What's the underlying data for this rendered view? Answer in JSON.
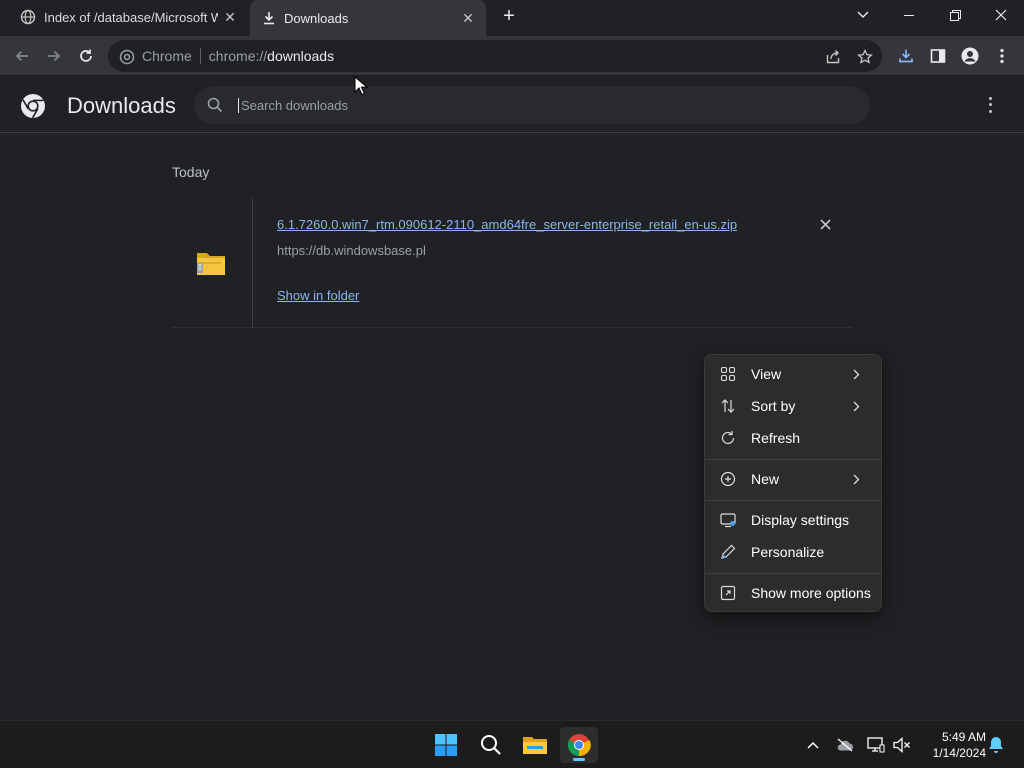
{
  "browser": {
    "tabs": [
      {
        "title": "Index of /database/Microsoft Wi",
        "active": false
      },
      {
        "title": "Downloads",
        "active": true
      }
    ],
    "omnibox": {
      "chip": "Chrome",
      "scheme": "chrome://",
      "host": "downloads"
    }
  },
  "downloads": {
    "title": "Downloads",
    "search_placeholder": "Search downloads",
    "section": "Today",
    "items": [
      {
        "filename": "6.1.7260.0.win7_rtm.090612-2110_amd64fre_server-enterprise_retail_en-us.zip",
        "source": "https://db.windowsbase.pl",
        "action": "Show in folder"
      }
    ]
  },
  "context_menu": {
    "items": [
      {
        "label": "View",
        "icon": "grid-icon",
        "submenu": true
      },
      {
        "label": "Sort by",
        "icon": "sort-icon",
        "submenu": true
      },
      {
        "label": "Refresh",
        "icon": "refresh-icon",
        "submenu": false
      },
      {
        "label": "New",
        "icon": "plus-circle-icon",
        "submenu": true
      },
      {
        "label": "Display settings",
        "icon": "display-icon",
        "submenu": false
      },
      {
        "label": "Personalize",
        "icon": "pen-icon",
        "submenu": false
      },
      {
        "label": "Show more options",
        "icon": "expand-icon",
        "submenu": false
      }
    ]
  },
  "taskbar": {
    "time": "5:49 AM",
    "date": "1/14/2024"
  },
  "colors": {
    "accent_link": "#8ab4f8",
    "background": "#202124",
    "menu_background": "#2c2c2c",
    "taskbar_indicator": "#60cdff"
  }
}
